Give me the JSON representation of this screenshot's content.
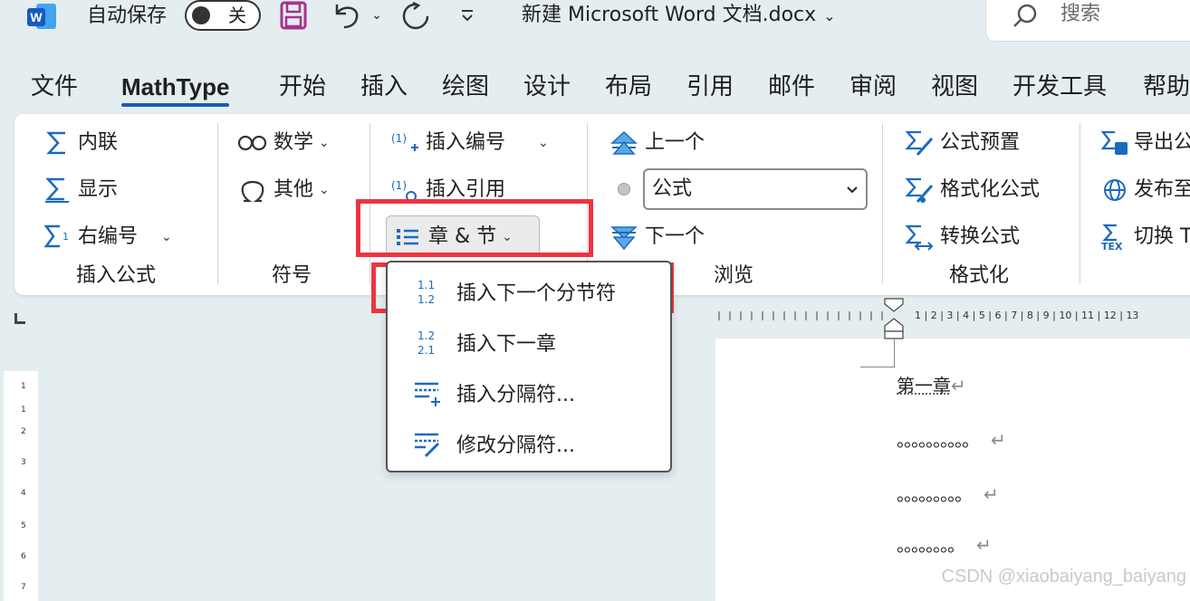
{
  "titlebar": {
    "logo_letter": "W",
    "autosave_label": "自动保存",
    "autosave_state": "关",
    "doc_title": "新建 Microsoft Word 文档.docx",
    "search_placeholder": "搜索"
  },
  "tabs": [
    {
      "label": "文件"
    },
    {
      "label": "MathType",
      "active": true
    },
    {
      "label": "开始"
    },
    {
      "label": "插入"
    },
    {
      "label": "绘图"
    },
    {
      "label": "设计"
    },
    {
      "label": "布局"
    },
    {
      "label": "引用"
    },
    {
      "label": "邮件"
    },
    {
      "label": "审阅"
    },
    {
      "label": "视图"
    },
    {
      "label": "开发工具"
    },
    {
      "label": "帮助"
    }
  ],
  "ribbon": {
    "insert_formula": {
      "inline": "内联",
      "display": "显示",
      "right_numbered": "右编号",
      "group_label": "插入公式"
    },
    "symbols": {
      "math": "数学",
      "other": "其他",
      "group_label": "符号"
    },
    "numbering": {
      "insert_number": "插入编号",
      "insert_reference": "插入引用",
      "chapter_section": "章 & 节"
    },
    "browse": {
      "previous": "上一个",
      "type_selected": "公式",
      "next": "下一个",
      "group_label": "浏览"
    },
    "format": {
      "preset": "公式预置",
      "format_equations": "格式化公式",
      "convert_equations": "转换公式",
      "group_label": "格式化"
    },
    "publish": {
      "export": "导出公",
      "publish": "发布至",
      "toggle": "切换 T"
    }
  },
  "menu": {
    "items": [
      {
        "label": "插入下一个分节符",
        "icon": "section-number-icon"
      },
      {
        "label": "插入下一章",
        "icon": "chapter-number-icon"
      },
      {
        "label": "插入分隔符...",
        "icon": "insert-break-icon"
      },
      {
        "label": "修改分隔符...",
        "icon": "modify-break-icon"
      }
    ]
  },
  "document": {
    "heading": "第一章",
    "lines": [
      "。。。。。。。。。。",
      "。。。。。。。。。",
      "。。。。。。。。"
    ],
    "paragraph_mark": "↵"
  },
  "ruler": {
    "numbers": [
      "1",
      "2",
      "3",
      "4",
      "5",
      "6",
      "7",
      "8",
      "9",
      "10",
      "11",
      "12",
      "13"
    ],
    "vnumbers": [
      "1",
      "1",
      "2",
      "3",
      "4",
      "5",
      "6",
      "7"
    ]
  },
  "watermark": "CSDN @xiaobaiyang_baiyang",
  "colors": {
    "accent": "#185abd",
    "highlight": "#ef3340",
    "icon_blue": "#1b6ac0",
    "background": "#e4edf0"
  }
}
